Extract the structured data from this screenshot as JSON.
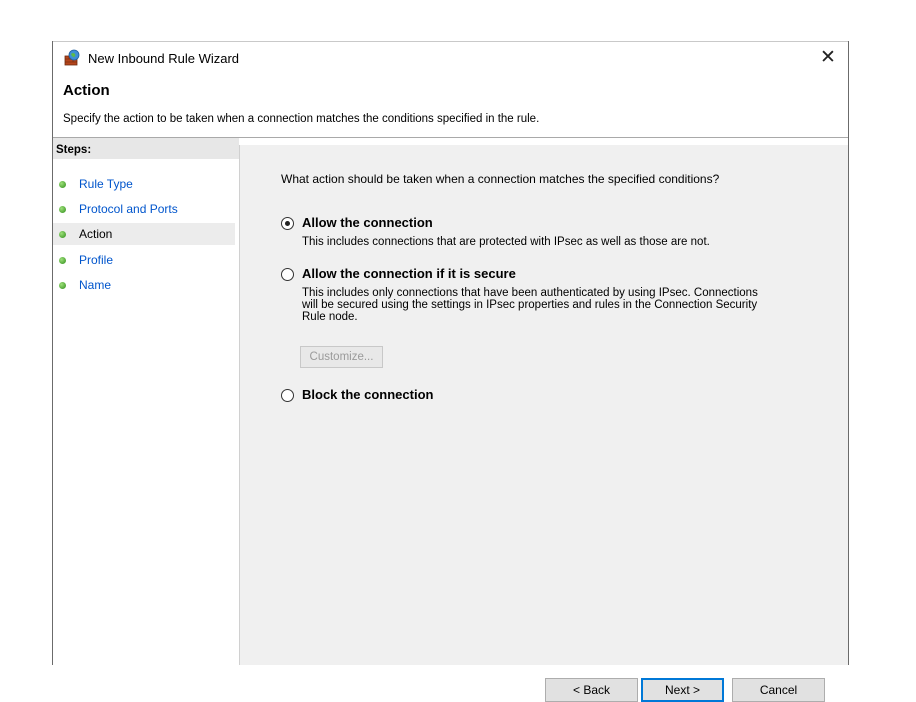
{
  "window": {
    "title": "New Inbound Rule Wizard",
    "close_glyph": "✕"
  },
  "page": {
    "heading": "Action",
    "description": "Specify the action to be taken when a connection matches the conditions specified in the rule."
  },
  "steps": {
    "title": "Steps:",
    "items": [
      {
        "label": "Rule Type",
        "state": "link"
      },
      {
        "label": "Protocol and Ports",
        "state": "link"
      },
      {
        "label": "Action",
        "state": "current"
      },
      {
        "label": "Profile",
        "state": "link"
      },
      {
        "label": "Name",
        "state": "link"
      }
    ]
  },
  "content": {
    "question": "What action should be taken when a connection matches the specified conditions?",
    "options": [
      {
        "label": "Allow the connection",
        "description": "This includes connections that are protected with IPsec as well as those are not.",
        "checked": true
      },
      {
        "label": "Allow the connection if it is secure",
        "description_lines": [
          "This includes only connections that have been authenticated by using IPsec.  Connections",
          "will be secured using the settings in IPsec properties and rules in the Connection Security",
          "Rule node."
        ],
        "checked": false
      },
      {
        "label": "Block the connection",
        "checked": false
      }
    ],
    "customize_label": "Customize..."
  },
  "buttons": {
    "back": "< Back",
    "next": "Next >",
    "cancel": "Cancel"
  },
  "icons": {
    "app": "firewall-wizard-icon",
    "close": "close-icon",
    "step_bullet": "green-dot-icon"
  },
  "colors": {
    "link": "#0055cc",
    "content_bg": "#f0f0f0",
    "accent": "#0078d7"
  }
}
